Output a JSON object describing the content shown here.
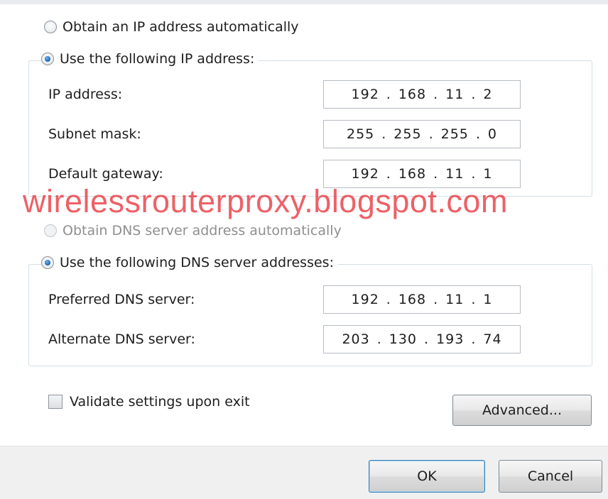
{
  "ip_section": {
    "auto_label": "Obtain an IP address automatically",
    "manual_label": "Use the following IP address:",
    "fields": [
      {
        "label": "IP address:",
        "octets": [
          "192",
          "168",
          "11",
          "2"
        ]
      },
      {
        "label": "Subnet mask:",
        "octets": [
          "255",
          "255",
          "255",
          "0"
        ]
      },
      {
        "label": "Default gateway:",
        "octets": [
          "192",
          "168",
          "11",
          "1"
        ]
      }
    ]
  },
  "watermark": "wirelessrouterproxy.blogspot.com",
  "dns_section": {
    "auto_label": "Obtain DNS server address automatically",
    "manual_label": "Use the following DNS server addresses:",
    "fields": [
      {
        "label": "Preferred DNS server:",
        "octets": [
          "192",
          "168",
          "11",
          "1"
        ]
      },
      {
        "label": "Alternate DNS server:",
        "octets": [
          "203",
          "130",
          "193",
          "74"
        ]
      }
    ]
  },
  "validate_label": "Validate settings upon exit",
  "buttons": {
    "advanced": "Advanced...",
    "ok": "OK",
    "cancel": "Cancel"
  }
}
